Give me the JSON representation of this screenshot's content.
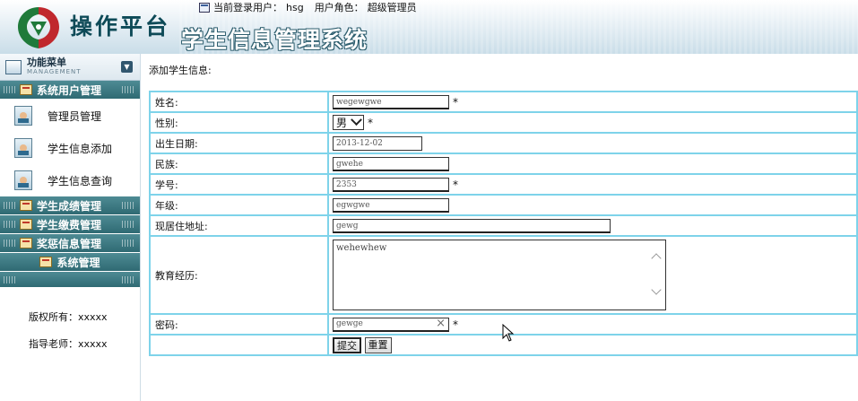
{
  "header": {
    "brand": "操作平台",
    "system_title": "学生信息管理系统",
    "current_user_label": "当前登录用户：",
    "current_user": "hsg",
    "role_label": "用户角色：",
    "role": "超级管理员"
  },
  "sidebar": {
    "menu_title": "功能菜单",
    "menu_subtitle": "MANAGEMENT",
    "groups": [
      {
        "label": "系统用户管理",
        "items": [
          "管理员管理",
          "学生信息添加",
          "学生信息查询"
        ]
      },
      {
        "label": "学生成绩管理"
      },
      {
        "label": "学生缴费管理"
      },
      {
        "label": "奖惩信息管理"
      },
      {
        "label": "系统管理"
      }
    ],
    "copyright": "版权所有：xxxxx",
    "advisor": "指导老师：xxxxx"
  },
  "form": {
    "title": "添加学生信息:",
    "fields": {
      "name": {
        "label": "姓名:",
        "value": "wegewgwe",
        "required": "*"
      },
      "gender": {
        "label": "性别:",
        "value": "男",
        "required": "*"
      },
      "birth": {
        "label": "出生日期:",
        "value": "2013-12-02"
      },
      "ethnicity": {
        "label": "民族:",
        "value": "gwehe"
      },
      "student_no": {
        "label": "学号:",
        "value": "2353",
        "required": "*"
      },
      "grade": {
        "label": "年级:",
        "value": "egwgwe"
      },
      "address": {
        "label": "现居住地址:",
        "value": "gewg"
      },
      "education": {
        "label": "教育经历:",
        "value": "wehewhew"
      },
      "password": {
        "label": "密码:",
        "value": "gewge",
        "required": "*"
      }
    },
    "submit_label": "提交",
    "reset_label": "重置"
  },
  "colors": {
    "accent": "#2f6a73",
    "table_border": "#7ed3ea"
  }
}
